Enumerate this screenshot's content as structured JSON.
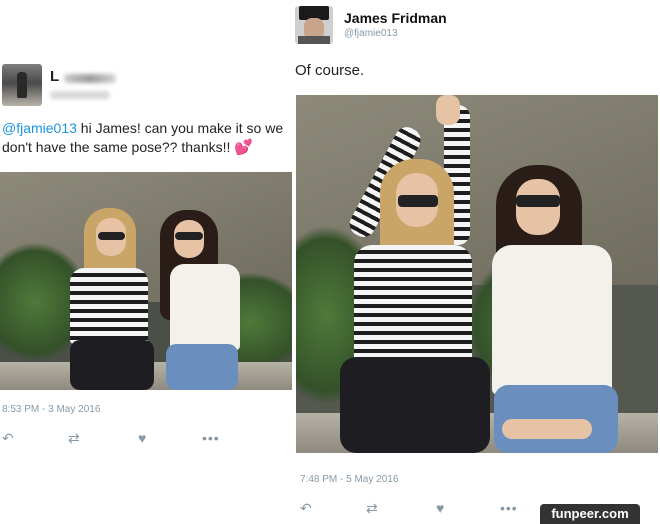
{
  "left_tweet": {
    "name": "L",
    "message_mention": "@fjamie013",
    "message_text": " hi James! can you make it so we don't have the same pose?? thanks!!",
    "message_emoji": "💕",
    "timestamp": "8:53 PM - 3 May 2016"
  },
  "right_tweet": {
    "name": "James Fridman",
    "handle": "@fjamie013",
    "message": "Of course.",
    "timestamp": "7:48 PM - 5 May 2016"
  },
  "actions": {
    "reply_icon": "reply-icon",
    "retweet_icon": "retweet-icon",
    "like_icon": "heart-icon",
    "more_icon": "more-icon"
  },
  "watermark": "funpeer.com"
}
